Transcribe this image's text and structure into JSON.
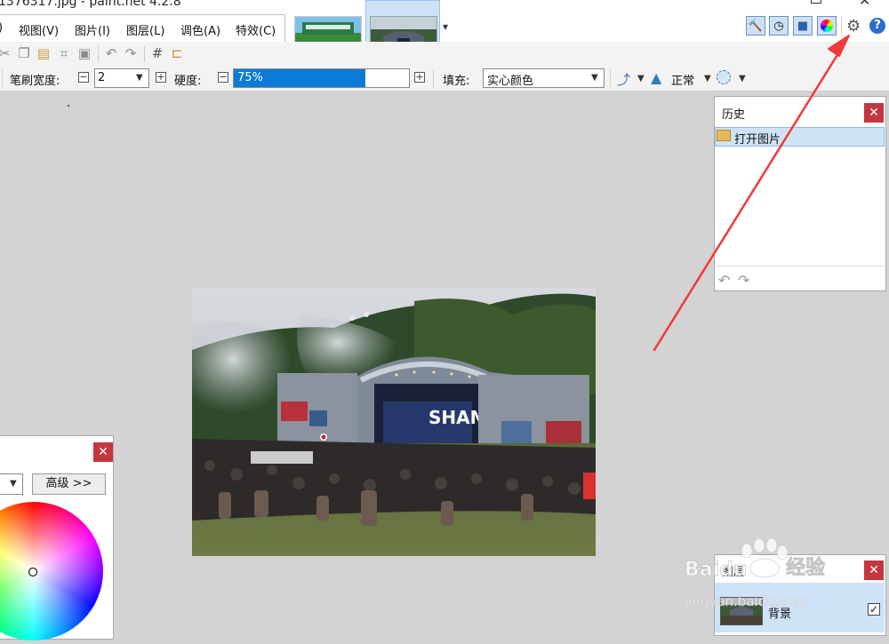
{
  "window": {
    "title": "1376317.jpg - paint.net 4.2.8"
  },
  "menu": {
    "items": [
      "视图(V)",
      "图片(I)",
      "图层(L)",
      "调色(A)",
      "特效(C)"
    ]
  },
  "options": {
    "brush_width_label": "笔刷宽度:",
    "brush_width_value": "2",
    "hardness_label": "硬度:",
    "hardness_value": "75%",
    "hardness_fraction": 0.75,
    "fill_label": "填充:",
    "fill_value": "实心颜色",
    "blend_mode": "正常"
  },
  "history": {
    "title": "历史",
    "items": [
      "打开图片"
    ]
  },
  "colors": {
    "advanced_label": "高级 >>"
  },
  "layers": {
    "title": "图层",
    "layer_name": "背景"
  },
  "watermark": {
    "brand": "Baidu",
    "site": "jingyan.baidu.com",
    "label": "经验"
  },
  "accent_colors": {
    "selection": "#cfe3f7",
    "hardness_bar": "#0a7ad8",
    "close": "#c4373e",
    "arrow": "#f0393b"
  }
}
